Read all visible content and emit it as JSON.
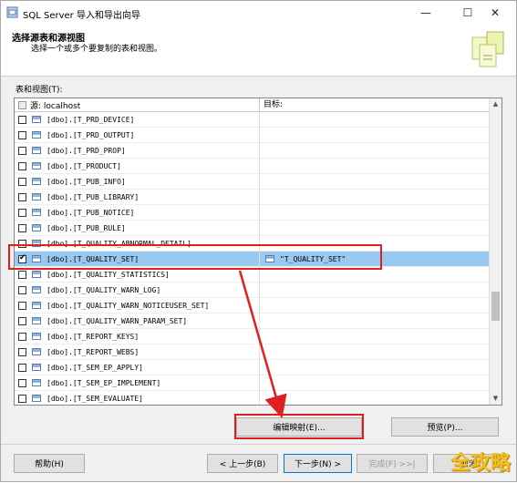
{
  "window": {
    "title": "SQL Server 导入和导出向导",
    "minimize_icon": "minimize-icon",
    "maximize_icon": "maximize-icon",
    "close_icon": "close-icon"
  },
  "header": {
    "title": "选择源表和源视图",
    "subtitle": "选择一个或多个要复制的表和视图。"
  },
  "grid": {
    "label": "表和视图(T):",
    "columns": {
      "source": "源: localhost",
      "destination": "目标:"
    },
    "rows": [
      {
        "name": "[dbo].[T_PRD_DEVICE]",
        "checked": false,
        "destination": ""
      },
      {
        "name": "[dbo].[T_PRD_OUTPUT]",
        "checked": false,
        "destination": ""
      },
      {
        "name": "[dbo].[T_PRD_PROP]",
        "checked": false,
        "destination": ""
      },
      {
        "name": "[dbo].[T_PRODUCT]",
        "checked": false,
        "destination": ""
      },
      {
        "name": "[dbo].[T_PUB_INFO]",
        "checked": false,
        "destination": ""
      },
      {
        "name": "[dbo].[T_PUB_LIBRARY]",
        "checked": false,
        "destination": ""
      },
      {
        "name": "[dbo].[T_PUB_NOTICE]",
        "checked": false,
        "destination": ""
      },
      {
        "name": "[dbo].[T_PUB_RULE]",
        "checked": false,
        "destination": ""
      },
      {
        "name": "[dbo].[T_QUALITY_ABNORMAL_DETAIL]",
        "checked": false,
        "destination": ""
      },
      {
        "name": "[dbo].[T_QUALITY_SET]",
        "checked": true,
        "destination": "\"T_QUALITY_SET\"",
        "selected": true
      },
      {
        "name": "[dbo].[T_QUALITY_STATISTICS]",
        "checked": false,
        "destination": ""
      },
      {
        "name": "[dbo].[T_QUALITY_WARN_LOG]",
        "checked": false,
        "destination": ""
      },
      {
        "name": "[dbo].[T_QUALITY_WARN_NOTICEUSER_SET]",
        "checked": false,
        "destination": ""
      },
      {
        "name": "[dbo].[T_QUALITY_WARN_PARAM_SET]",
        "checked": false,
        "destination": ""
      },
      {
        "name": "[dbo].[T_REPORT_KEYS]",
        "checked": false,
        "destination": ""
      },
      {
        "name": "[dbo].[T_REPORT_WEBS]",
        "checked": false,
        "destination": ""
      },
      {
        "name": "[dbo].[T_SEM_EP_APPLY]",
        "checked": false,
        "destination": ""
      },
      {
        "name": "[dbo].[T_SEM_EP_IMPLEMENT]",
        "checked": false,
        "destination": ""
      },
      {
        "name": "[dbo].[T_SEM_EVALUATE]",
        "checked": false,
        "destination": ""
      }
    ]
  },
  "actions": {
    "edit_mappings": "编辑映射(E)...",
    "preview": "预览(P)..."
  },
  "footer": {
    "help": "帮助(H)",
    "back": "< 上一步(B)",
    "next": "下一步(N) >",
    "finish": "完成(F) >>|",
    "cancel": "取消"
  },
  "watermark": "全攻略"
}
